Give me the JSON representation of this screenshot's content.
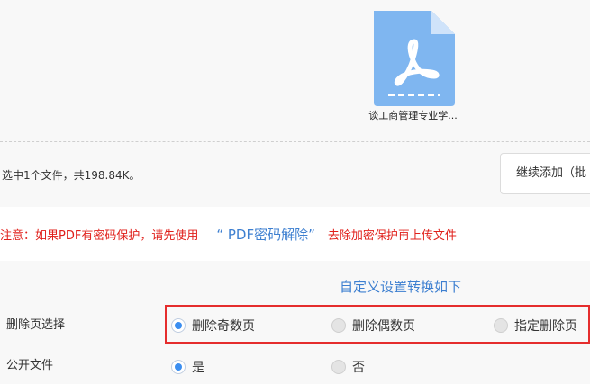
{
  "file": {
    "name": "谈工商管理专业学...",
    "icon": "pdf-file-icon",
    "icon_color": "#7fb6f0"
  },
  "status": {
    "summary": "选中1个文件，共198.84K。",
    "continue_button": "继续添加（批"
  },
  "warning": {
    "prefix": "注意：如果PDF有密码保护，请先使用",
    "link": "“ PDF密码解除”",
    "suffix": "去除加密保护再上传文件",
    "color": "#e0201b",
    "link_color": "#3d7fd0"
  },
  "settings": {
    "title": "自定义设置转换如下",
    "delete_pages": {
      "label": "删除页选择",
      "options": [
        "删除奇数页",
        "删除偶数页",
        "指定删除页"
      ],
      "selected": "删除奇数页"
    },
    "public_file": {
      "label": "公开文件",
      "options": [
        "是",
        "否"
      ],
      "selected": "是"
    }
  },
  "colors": {
    "accent": "#3b8ef0",
    "highlight_border": "#e52d2d",
    "panel_bg": "#f8f8f8"
  }
}
